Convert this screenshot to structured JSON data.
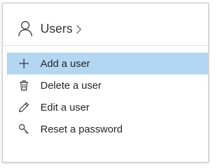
{
  "header": {
    "title": "Users",
    "icon": "user-icon",
    "chevron_icon": "chevron-right-icon"
  },
  "menu": {
    "items": [
      {
        "label": "Add a user",
        "icon": "plus-icon",
        "selected": true
      },
      {
        "label": "Delete a user",
        "icon": "trash-icon",
        "selected": false
      },
      {
        "label": "Edit a user",
        "icon": "pencil-icon",
        "selected": false
      },
      {
        "label": "Reset a password",
        "icon": "key-icon",
        "selected": false
      }
    ]
  },
  "colors": {
    "selected_background": "#b3d7f3",
    "text": "#252525",
    "border": "#c8c8c8"
  }
}
